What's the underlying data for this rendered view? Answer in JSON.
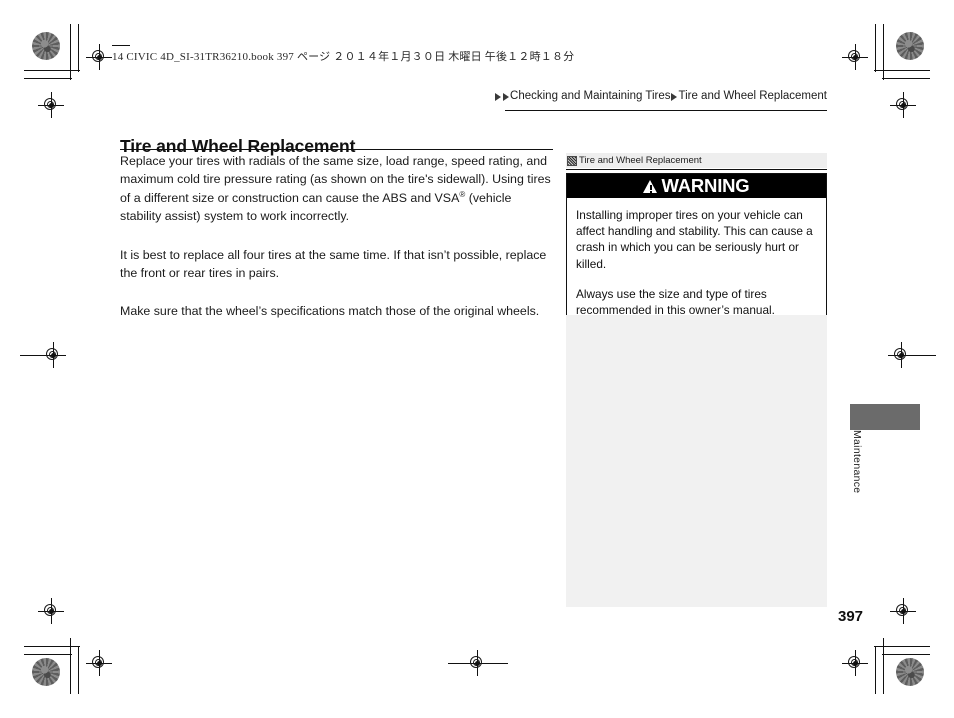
{
  "print_header": {
    "text": "14 CIVIC 4D_SI-31TR36210.book   397 ページ   ２０１４年１月３０日   木曜日   午後１２時１８分"
  },
  "breadcrumb": {
    "items": [
      "Checking and Maintaining Tires",
      "Tire and Wheel Replacement"
    ],
    "separator_icon": "triangle-right-icon"
  },
  "main": {
    "title": "Tire and Wheel Replacement",
    "paragraphs": [
      {
        "before": "Replace your tires with radials of the same size, load range, speed rating, and maximum cold tire pressure rating (as shown on the tire's sidewall). Using tires of a different size or construction can cause the ABS and VSA",
        "sup": "®",
        "after": " (vehicle stability assist) system to work incorrectly."
      },
      {
        "before": "It is best to replace all four tires at the same time. If that isn’t possible, replace the front or rear tires in pairs.",
        "sup": "",
        "after": ""
      },
      {
        "before": "Make sure that the wheel’s specifications match those of the original wheels.",
        "sup": "",
        "after": ""
      }
    ]
  },
  "sidebar": {
    "section_icon": "hatched-square-icon",
    "section_label": "Tire and Wheel Replacement",
    "warning": {
      "icon": "warning-triangle-icon",
      "title": "WARNING",
      "paragraphs": [
        "Installing improper tires on your vehicle can affect handling and stability. This can cause a crash in which you can be seriously hurt or killed.",
        "Always use the size and type of tires recommended in this owner’s manual."
      ]
    }
  },
  "edge_tab": {
    "label": "Maintenance",
    "color": "#6b6b6b"
  },
  "footer": {
    "page_number": "397"
  },
  "colors": {
    "warning_banner_bg": "#000000",
    "warning_banner_text": "#ffffff",
    "side_head_bg": "#eeeeee",
    "side_filler_bg": "#f1f1f1",
    "rule": "#111111"
  }
}
